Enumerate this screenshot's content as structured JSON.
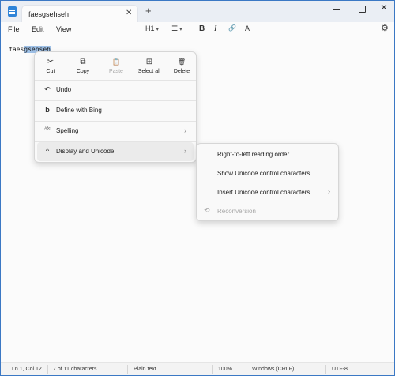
{
  "tab": {
    "title": "faesgsehseh",
    "close": "✕",
    "new": "+"
  },
  "window": {
    "close": "✕"
  },
  "menubar": {
    "file": "File",
    "edit": "Edit",
    "view": "View"
  },
  "toolbar": {
    "heading": "H1",
    "list": "☰",
    "bold": "B",
    "italic": "I",
    "link": "🔗",
    "clear_format": "A",
    "settings": "⚙"
  },
  "document": {
    "text_before": "faes",
    "text_selected": "gsehseh",
    "text_after": ""
  },
  "context_menu": {
    "actions": [
      {
        "label": "Cut",
        "icon": "✂"
      },
      {
        "label": "Copy",
        "icon": "⧉"
      },
      {
        "label": "Paste",
        "icon": "📋"
      },
      {
        "label": "Select all",
        "icon": "⊞"
      },
      {
        "label": "Delete",
        "icon": "🗑"
      }
    ],
    "items": [
      {
        "label": "Undo",
        "icon": "↶"
      },
      {
        "label": "Define with Bing",
        "icon": "b"
      },
      {
        "label": "Spelling",
        "icon": "ᴬᴮᶜ"
      },
      {
        "label": "Display and Unicode",
        "icon": "^"
      }
    ]
  },
  "submenu": {
    "items": [
      {
        "label": "Right-to-left reading order"
      },
      {
        "label": "Show Unicode control characters"
      },
      {
        "label": "Insert Unicode control characters"
      },
      {
        "label": "Reconversion",
        "icon": "⟲"
      }
    ]
  },
  "statusbar": {
    "position": "Ln 1, Col 12",
    "selection": "7 of 11 characters",
    "format": "Plain text",
    "zoom": "100%",
    "line_ending": "Windows (CRLF)",
    "encoding": "UTF-8"
  }
}
